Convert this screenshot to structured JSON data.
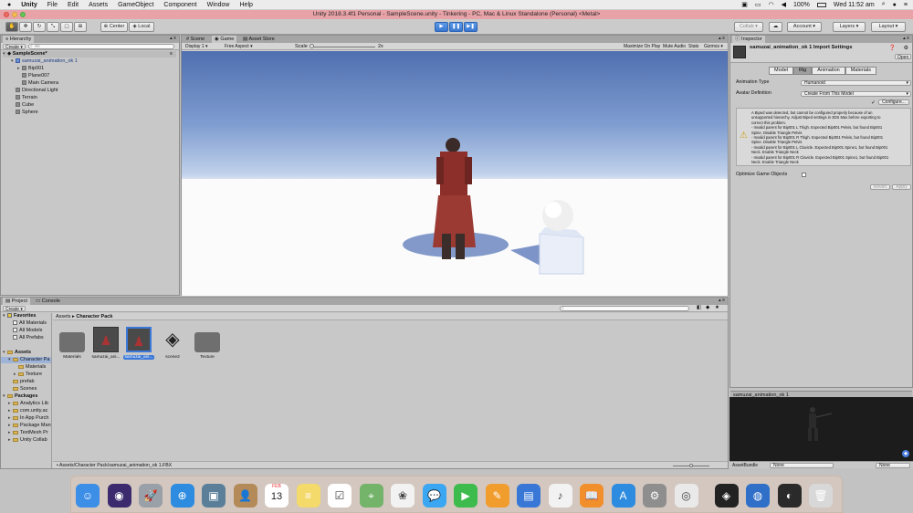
{
  "menubar": {
    "apple": "",
    "items": [
      "Unity",
      "File",
      "Edit",
      "Assets",
      "GameObject",
      "Component",
      "Window",
      "Help"
    ],
    "status_percent": "100%",
    "clock": "Wed 11:52 am"
  },
  "window_title": "Unity 2018.3.4f1 Personal - SampleScene.unity - Tinkering - PC, Mac & Linux Standalone (Personal) <Metal>",
  "toolbar": {
    "center_label": "Center",
    "local_label": "Local",
    "collab_label": "Collab",
    "account_label": "Account",
    "layers_label": "Layers",
    "layout_label": "Layout"
  },
  "hierarchy": {
    "tab_label": "Hierarchy",
    "create_label": "Create",
    "search_placeholder": "All",
    "scene_name": "SampleScene*",
    "items": [
      {
        "label": "samuzai_animation_ok 1",
        "indent": 1,
        "expand": "▾"
      },
      {
        "label": "Bip001",
        "indent": 2,
        "expand": "▸"
      },
      {
        "label": "Plane007",
        "indent": 2,
        "expand": ""
      },
      {
        "label": "Main Camera",
        "indent": 2,
        "expand": ""
      },
      {
        "label": "Directional Light",
        "indent": 1,
        "expand": ""
      },
      {
        "label": "Terrain",
        "indent": 1,
        "expand": ""
      },
      {
        "label": "Cube",
        "indent": 1,
        "expand": ""
      },
      {
        "label": "Sphere",
        "indent": 1,
        "expand": ""
      }
    ]
  },
  "scene_tabs": {
    "scene": "Scene",
    "game": "Game",
    "asset_store": "Asset Store"
  },
  "game_bar": {
    "display": "Display 1",
    "aspect": "Free Aspect",
    "scale_label": "Scale",
    "scale_value": "2x",
    "maximize": "Maximize On Play",
    "mute": "Mute Audio",
    "stats": "Stats",
    "gizmos": "Gizmos"
  },
  "inspector": {
    "tab_label": "Inspector",
    "title": "samuzai_animation_ok 1 Import Settings",
    "open_label": "Open",
    "tabs": [
      "Model",
      "Rig",
      "Animation",
      "Materials"
    ],
    "animation_type_label": "Animation Type",
    "animation_type_value": "Humanoid",
    "avatar_definition_label": "Avatar Definition",
    "avatar_definition_value": "Create From This Model",
    "configure_label": "Configure...",
    "warning_lines": [
      "A Biped was detected, but cannot be configured properly because of an",
      "unsupported hierarchy. Adjust Biped settings in 3DS Max before exporting to",
      "correct this problem.",
      "- Invalid parent for Bip001 L Thigh. Expected Bip001 Pelvis, but found Bip001",
      "Spine. Disable Triangle Pelvis",
      "- Invalid parent for Bip001 R Thigh. Expected Bip001 Pelvis, but found Bip001",
      "Spine. Disable Triangle Pelvis",
      "- Invalid parent for Bip001 L Clavicle. Expected Bip001 Spine1, but found Bip001",
      "Neck. Enable Triangle Neck",
      "- Invalid parent for Bip001 R Clavicle. Expected Bip001 Spine1, but found Bip001",
      "Neck. Enable Triangle Neck"
    ],
    "optimize_label": "Optimize Game Objects",
    "revert_label": "Revert",
    "apply_label": "Apply",
    "preview_title": "samuzai_animation_ok 1",
    "asset_bundle_label": "AssetBundle",
    "asset_bundle_value": "None",
    "asset_bundle_variant": "None"
  },
  "project": {
    "tab_project": "Project",
    "tab_console": "Console",
    "create_label": "Create",
    "breadcrumb_root": "Assets",
    "breadcrumb_current": "Character Pack",
    "tree": [
      {
        "label": "Favorites",
        "bold": true,
        "indent": 0,
        "expand": "▾",
        "kind": "fav"
      },
      {
        "label": "All Materials",
        "bold": false,
        "indent": 1,
        "expand": "",
        "kind": "search"
      },
      {
        "label": "All Models",
        "bold": false,
        "indent": 1,
        "expand": "",
        "kind": "search"
      },
      {
        "label": "All Prefabs",
        "bold": false,
        "indent": 1,
        "expand": "",
        "kind": "search"
      },
      {
        "label": "",
        "bold": false,
        "indent": 0,
        "expand": "",
        "kind": "spacer"
      },
      {
        "label": "Assets",
        "bold": true,
        "indent": 0,
        "expand": "▾",
        "kind": "folder"
      },
      {
        "label": "Character Pa",
        "bold": false,
        "indent": 1,
        "expand": "▾",
        "kind": "folder",
        "selected": true
      },
      {
        "label": "Materials",
        "bold": false,
        "indent": 2,
        "expand": "",
        "kind": "folder"
      },
      {
        "label": "Texture",
        "bold": false,
        "indent": 2,
        "expand": "▸",
        "kind": "folder"
      },
      {
        "label": "prefab",
        "bold": false,
        "indent": 1,
        "expand": "",
        "kind": "folder"
      },
      {
        "label": "Scenes",
        "bold": false,
        "indent": 1,
        "expand": "",
        "kind": "folder"
      },
      {
        "label": "Packages",
        "bold": true,
        "indent": 0,
        "expand": "▾",
        "kind": "folder"
      },
      {
        "label": "Analytics Lib",
        "bold": false,
        "indent": 1,
        "expand": "▸",
        "kind": "folder"
      },
      {
        "label": "com.unity.ac",
        "bold": false,
        "indent": 1,
        "expand": "▸",
        "kind": "folder"
      },
      {
        "label": "In App Purch",
        "bold": false,
        "indent": 1,
        "expand": "▸",
        "kind": "folder"
      },
      {
        "label": "Package Man",
        "bold": false,
        "indent": 1,
        "expand": "▸",
        "kind": "folder"
      },
      {
        "label": "TextMesh Pr",
        "bold": false,
        "indent": 1,
        "expand": "▸",
        "kind": "folder"
      },
      {
        "label": "Unity Collab",
        "bold": false,
        "indent": 1,
        "expand": "▸",
        "kind": "folder"
      }
    ],
    "assets": [
      {
        "label": "Materials",
        "kind": "folder"
      },
      {
        "label": "samuzai_ani...",
        "kind": "model"
      },
      {
        "label": "samuzai_ani...",
        "kind": "model",
        "selected": true
      },
      {
        "label": "scene2",
        "kind": "unity"
      },
      {
        "label": "Texture",
        "kind": "folder"
      }
    ],
    "status_path": "Assets/Character Pack/samuzai_animation_ok 1.FBX"
  },
  "dock": {
    "apps": [
      "finder",
      "siri",
      "launchpad",
      "safari",
      "photos-viewer",
      "contacts",
      "calendar",
      "notes",
      "reminders",
      "maps",
      "photos",
      "messages",
      "facetime",
      "pages",
      "keynote",
      "itunes",
      "books",
      "app-store",
      "system-preferences",
      "chrome",
      "unity",
      "globe",
      "photo-booth",
      "trash"
    ],
    "calendar_month": "FEB",
    "calendar_day": "13"
  }
}
